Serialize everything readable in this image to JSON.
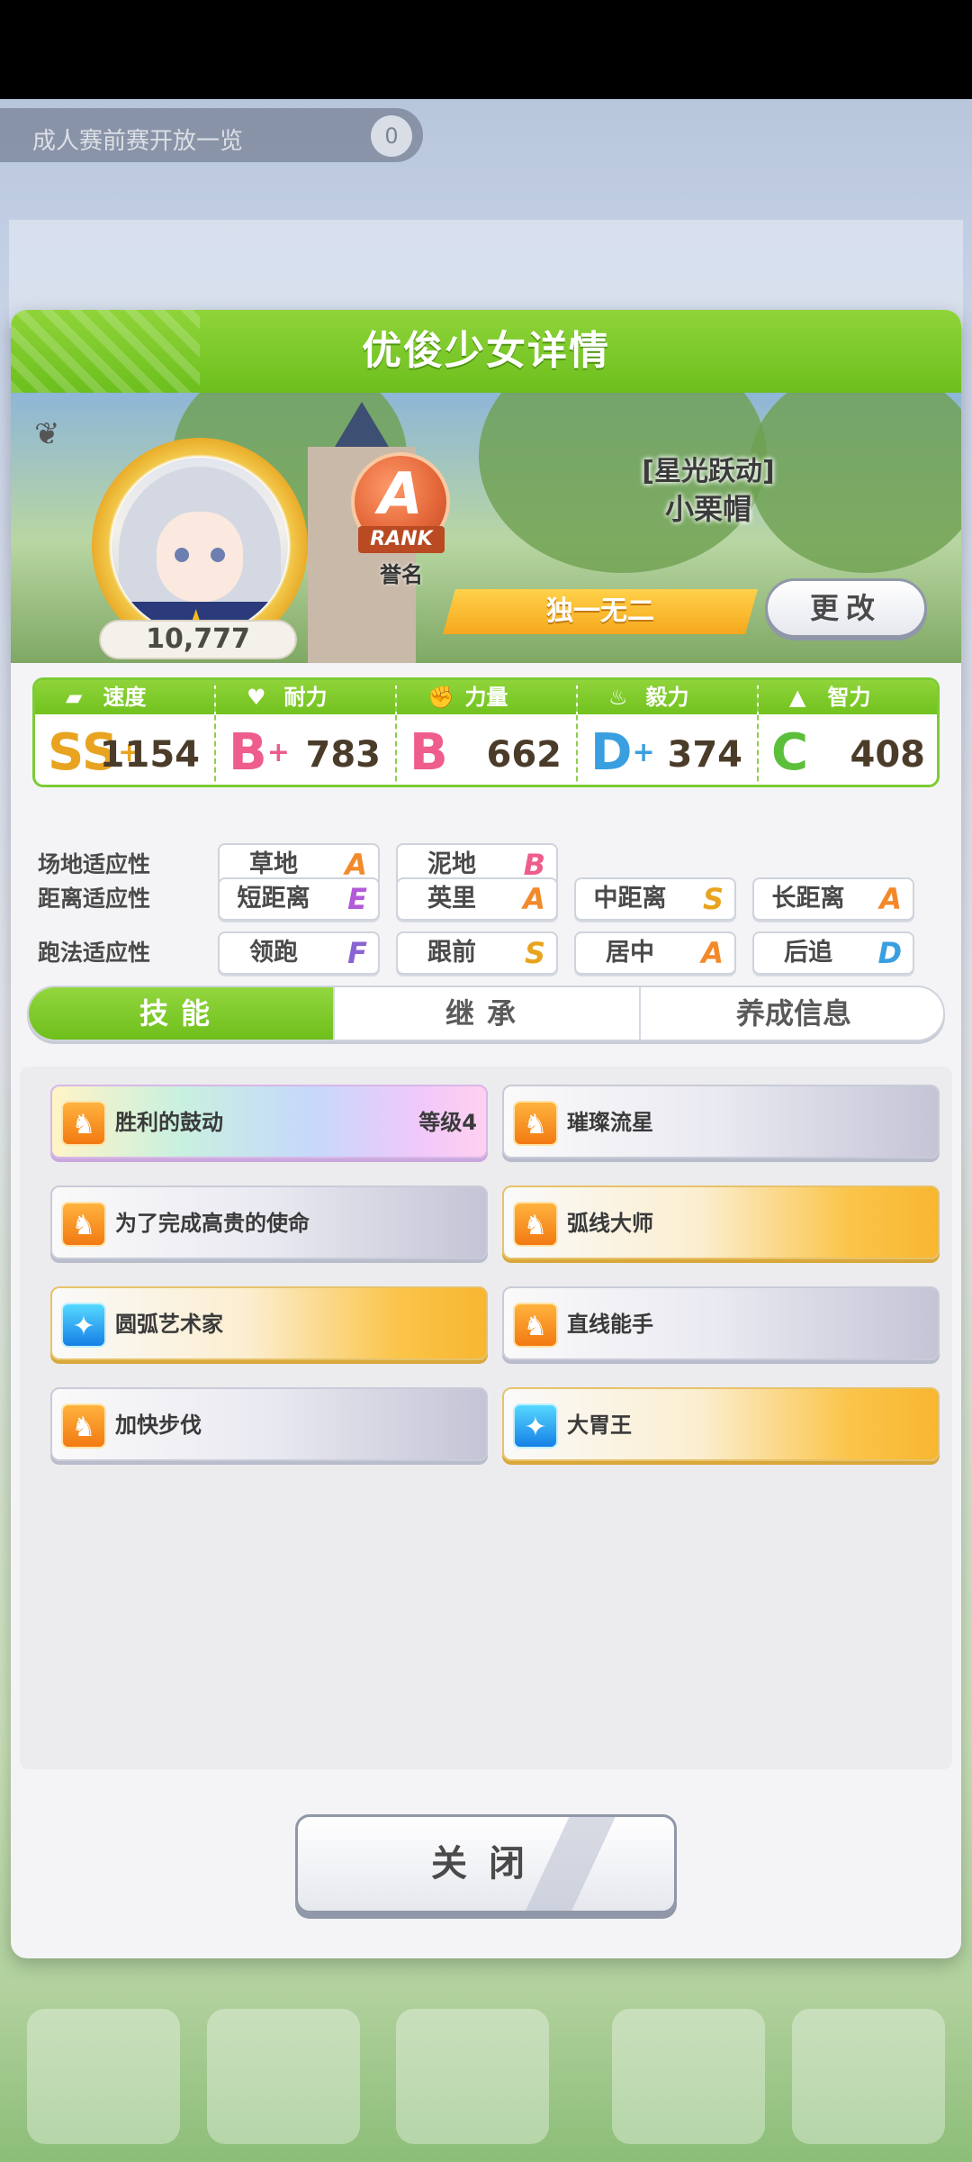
{
  "background": {
    "notice_text": "成人赛前赛开放一览",
    "notice_badge": "0"
  },
  "dialog": {
    "title": "优俊少女详情",
    "character": {
      "fans": "10,777",
      "rank_letter": "A",
      "rank_ribbon": "RANK",
      "rank_sub": "誉名",
      "epithet": "[星光跃动]",
      "name": "小栗帽",
      "title_banner": "独一无二",
      "change_label": "更改"
    },
    "stats": [
      {
        "label": "速度",
        "icon": "shoe-icon",
        "grade": "SS",
        "plus": "+",
        "value": "1154",
        "color": "#e8a420"
      },
      {
        "label": "耐力",
        "icon": "heart-icon",
        "grade": "B",
        "plus": "+",
        "value": "783",
        "color": "#ee5d8c"
      },
      {
        "label": "力量",
        "icon": "muscle-icon",
        "grade": "B",
        "plus": "",
        "value": "662",
        "color": "#ee5d8c"
      },
      {
        "label": "毅力",
        "icon": "flame-icon",
        "grade": "D",
        "plus": "+",
        "value": "374",
        "color": "#3a9fe0"
      },
      {
        "label": "智力",
        "icon": "graduation-cap-icon",
        "grade": "C",
        "plus": "",
        "value": "408",
        "color": "#5cbf3a"
      }
    ],
    "aptitudes": {
      "field": {
        "label": "场地适应性",
        "items": [
          {
            "name": "草地",
            "grade": "A"
          },
          {
            "name": "泥地",
            "grade": "B"
          }
        ]
      },
      "distance": {
        "label": "距离适应性",
        "items": [
          {
            "name": "短距离",
            "grade": "E"
          },
          {
            "name": "英里",
            "grade": "A"
          },
          {
            "name": "中距离",
            "grade": "S"
          },
          {
            "name": "长距离",
            "grade": "A"
          }
        ]
      },
      "style": {
        "label": "跑法适应性",
        "items": [
          {
            "name": "领跑",
            "grade": "F"
          },
          {
            "name": "跟前",
            "grade": "S"
          },
          {
            "name": "居中",
            "grade": "A"
          },
          {
            "name": "后追",
            "grade": "D"
          }
        ]
      }
    },
    "grade_colors": {
      "A": "#f2892a",
      "B": "#ee5d8c",
      "S": "#e8a420",
      "E": "#b25ad8",
      "F": "#8a63d2",
      "D": "#3a9fe0"
    },
    "tabs": [
      "技能",
      "继承",
      "养成信息"
    ],
    "skills": [
      {
        "name": "胜利的鼓动",
        "level": "等级4",
        "style": "rainbow",
        "icon": "speed"
      },
      {
        "name": "璀璨流星",
        "level": "",
        "style": "white",
        "icon": "speed"
      },
      {
        "name": "为了完成高贵的使命",
        "level": "",
        "style": "white",
        "icon": "speed"
      },
      {
        "name": "弧线大师",
        "level": "",
        "style": "gold",
        "icon": "speed"
      },
      {
        "name": "圆弧艺术家",
        "level": "",
        "style": "gold",
        "icon": "recover"
      },
      {
        "name": "直线能手",
        "level": "",
        "style": "white",
        "icon": "speed"
      },
      {
        "name": "加快步伐",
        "level": "",
        "style": "white",
        "icon": "speed"
      },
      {
        "name": "大胃王",
        "level": "",
        "style": "gold",
        "icon": "recover"
      }
    ],
    "close_label": "关闭"
  }
}
